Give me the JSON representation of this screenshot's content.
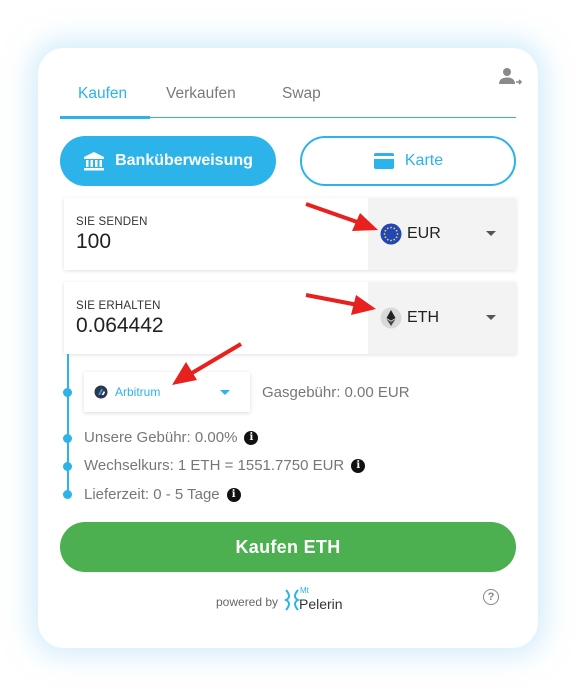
{
  "tabs": [
    {
      "label": "Kaufen",
      "active": true
    },
    {
      "label": "Verkaufen",
      "active": false
    },
    {
      "label": "Swap",
      "active": false
    }
  ],
  "icons": {
    "account": "user-transfer-icon",
    "bank": "bank-icon",
    "card": "credit-card-icon",
    "info": "info-icon",
    "help": "help-icon"
  },
  "payment": {
    "bank_label": "Banküberweisung",
    "card_label": "Karte"
  },
  "send": {
    "label": "SIE SENDEN",
    "amount": "100",
    "currency": "EUR"
  },
  "receive": {
    "label": "SIE ERHALTEN",
    "amount": "0.064442",
    "currency": "ETH"
  },
  "network": {
    "name": "Arbitrum",
    "gas_fee": "Gasgebühr: 0.00 EUR"
  },
  "details": {
    "fee": "Unsere Gebühr: 0.00%",
    "rate": "Wechselkurs: 1 ETH = 1551.7750 EUR",
    "delivery": "Lieferzeit: 0 - 5 Tage"
  },
  "buy_button": "Kaufen ETH",
  "footer": {
    "powered_by": "powered by",
    "brand_mt": "Mt",
    "brand_name": "Pelerin",
    "help": "?"
  },
  "colors": {
    "accent": "#2bb3ea",
    "buy": "#4caf50",
    "annotation_arrow": "#e8211f"
  }
}
